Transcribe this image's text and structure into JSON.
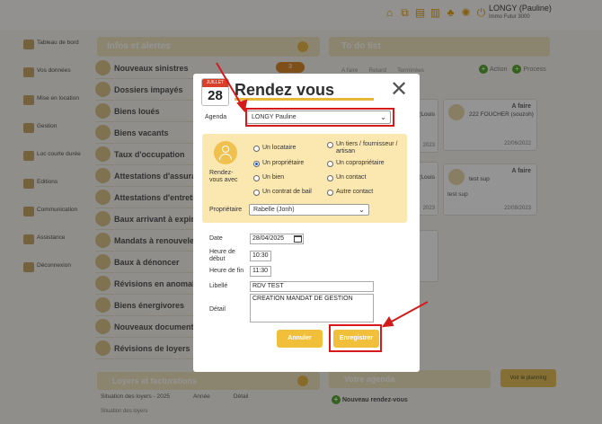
{
  "header": {
    "user_name": "LONGY (Pauline)",
    "user_sub": "Immo Futur 3000",
    "icons": [
      "home-icon",
      "external-link-icon",
      "document-icon",
      "book-icon",
      "tree-icon",
      "gear-icon",
      "power-icon"
    ]
  },
  "sidebar": {
    "items": [
      {
        "label": "Tableau de bord",
        "icon": "dashboard-icon"
      },
      {
        "label": "Vos données",
        "icon": "user-data-icon"
      },
      {
        "label": "Mise en location",
        "icon": "rental-icon"
      },
      {
        "label": "Gestion",
        "icon": "management-icon"
      },
      {
        "label": "Loc courte durée",
        "icon": "short-stay-icon"
      },
      {
        "label": "Editions",
        "icon": "editions-icon"
      },
      {
        "label": "Communication",
        "icon": "communication-icon"
      },
      {
        "label": "Assistance",
        "icon": "assistance-icon"
      },
      {
        "label": "Déconnexion",
        "icon": "logout-icon"
      }
    ]
  },
  "infos": {
    "title": "Infos et alertes",
    "badge_count": "3",
    "items": [
      "Nouveaux sinistres",
      "Dossiers impayés",
      "Biens loués",
      "Biens vacants",
      "Taux d'occupation",
      "Attestations d'assurance",
      "Attestations d'entretien",
      "Baux arrivant à expiration",
      "Mandats à renouveler",
      "Baux à dénoncer",
      "Révisions en anomalie",
      "Biens énergivores",
      "Nouveaux documents",
      "Révisions de loyers"
    ]
  },
  "todo": {
    "title": "To do list",
    "tabs": [
      "A faire",
      "Retard",
      "Terminées"
    ],
    "action_label": "Action",
    "process_label": "Process",
    "cards": [
      {
        "status": "A faire",
        "title": "222 FOUCHER (souzoh)",
        "date": "22/06/2022",
        "sub": ""
      },
      {
        "status": "A faire",
        "title": "test sup",
        "date": "22/08/2023",
        "sub": "test sup"
      }
    ],
    "left_partial": [
      "(Louis",
      "2023",
      "(Louis",
      "2023"
    ]
  },
  "loyers": {
    "title": "Loyers et facturations",
    "row_label": "Situation des loyers - 2025",
    "col_annee": "Année",
    "col_detail": "Détail",
    "broken_img": "Situation des loyers"
  },
  "agenda_panel": {
    "title": "Votre agenda",
    "planning_btn": "Voir le planning",
    "new_rdv": "Nouveau rendez-vous"
  },
  "modal": {
    "title": "Rendez vous",
    "calendar_month": "JUILLET",
    "calendar_day": "28",
    "agenda_label": "Agenda",
    "agenda_value": "LONGY Pauline",
    "rdv_label": "Rendez-vous avec",
    "options": [
      {
        "label": "Un locataire",
        "checked": false
      },
      {
        "label": "Un tiers / fournisseur / artisan",
        "checked": false
      },
      {
        "label": "Un propriétaire",
        "checked": true
      },
      {
        "label": "Un copropriétaire",
        "checked": false
      },
      {
        "label": "Un bien",
        "checked": false
      },
      {
        "label": "Un contact",
        "checked": false
      },
      {
        "label": "Un contrat de bail",
        "checked": false
      },
      {
        "label": "Autre contact",
        "checked": false
      }
    ],
    "proprietaire_label": "Propriétaire",
    "proprietaire_value": "Rabelle (Jonh)",
    "date_label": "Date",
    "date_value": "28/04/2025",
    "heure_debut_label": "Heure de début",
    "heure_debut_value": "10:30",
    "heure_fin_label": "Heure de fin",
    "heure_fin_value": "11:30",
    "libelle_label": "Libellé",
    "libelle_value": "RDV TEST",
    "detail_label": "Détail",
    "detail_value": "CREATION MANDAT DE GESTION",
    "cancel_label": "Annuler",
    "save_label": "Enregistrer",
    "highlight_color": "#d41a1a",
    "accent_color": "#f1bf3a"
  }
}
